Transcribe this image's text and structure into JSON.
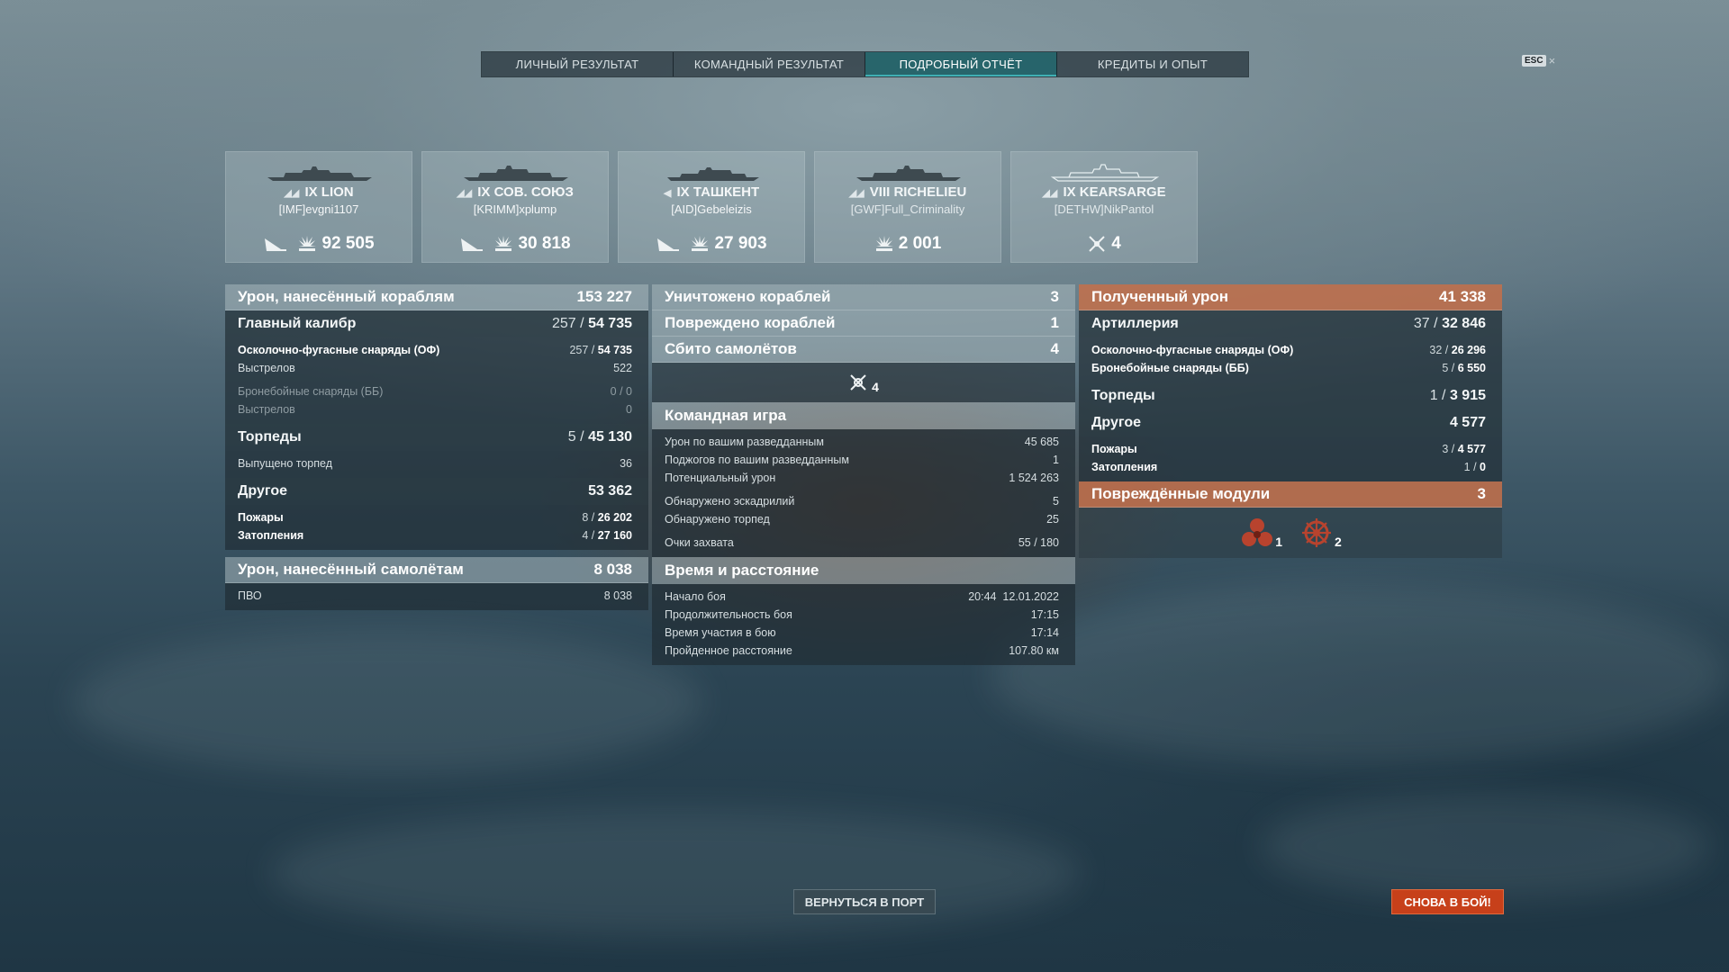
{
  "tabs": [
    {
      "label": "ЛИЧНЫЙ РЕЗУЛЬТАТ",
      "active": false
    },
    {
      "label": "КОМАНДНЫЙ РЕЗУЛЬТАТ",
      "active": false
    },
    {
      "label": "ПОДРОБНЫЙ ОТЧЁТ",
      "active": true
    },
    {
      "label": "КРЕДИТЫ И ОПЫТ",
      "active": false
    }
  ],
  "esc": {
    "key": "ESC",
    "close": "×"
  },
  "ships": [
    {
      "tier": "IX",
      "name": "LION",
      "player": "[IMF]evgni1107",
      "damage": "92 505"
    },
    {
      "tier": "IX",
      "name": "СОВ. СОЮЗ",
      "player": "[KRIMM]xplump",
      "damage": "30 818"
    },
    {
      "tier": "IX",
      "name": "ТАШКЕНТ",
      "player": "[AID]Gebeleizis",
      "damage": "27 903"
    },
    {
      "tier": "VIII",
      "name": "RICHELIEU",
      "player": "[GWF]Full_Criminality",
      "damage": "2 001"
    },
    {
      "tier": "IX",
      "name": "KEARSARGE",
      "player": "[DETHW]NikPantol",
      "planes": "4"
    }
  ],
  "left": {
    "ship_damage": {
      "label": "Урон, нанесённый кораблям",
      "value": "153 227"
    },
    "main_battery": {
      "label": "Главный калибр",
      "hits": "257",
      "sep": "/",
      "damage": "54 735"
    },
    "he": {
      "label": "Осколочно-фугасные снаряды (ОФ)",
      "hits": "257",
      "sep": "/",
      "damage": "54 735"
    },
    "he_shots": {
      "label": "Выстрелов",
      "value": "522"
    },
    "ap": {
      "label": "Бронебойные снаряды (ББ)",
      "value": "0 / 0"
    },
    "ap_shots": {
      "label": "Выстрелов",
      "value": "0"
    },
    "torpedoes": {
      "label": "Торпеды",
      "hits": "5",
      "sep": "/",
      "damage": "45 130"
    },
    "torp_launched": {
      "label": "Выпущено торпед",
      "value": "36"
    },
    "other": {
      "label": "Другое",
      "value": "53 362"
    },
    "fires": {
      "label": "Пожары",
      "count": "8",
      "sep": "/",
      "damage": "26 202"
    },
    "floods": {
      "label": "Затопления",
      "count": "4",
      "sep": "/",
      "damage": "27 160"
    },
    "plane_damage": {
      "label": "Урон, нанесённый самолётам",
      "value": "8 038"
    },
    "aa": {
      "label": "ПВО",
      "value": "8 038"
    }
  },
  "middle": {
    "destroyed": {
      "label": "Уничтожено кораблей",
      "value": "3"
    },
    "damaged": {
      "label": "Повреждено кораблей",
      "value": "1"
    },
    "planes": {
      "label": "Сбито самолётов",
      "value": "4"
    },
    "planes_icon_value": "4",
    "teamplay": {
      "title": "Командная игра",
      "rows": [
        {
          "label": "Урон по вашим разведданным",
          "value": "45 685"
        },
        {
          "label": "Поджогов по вашим разведданным",
          "value": "1"
        },
        {
          "label": "Потенциальный урон",
          "value": "1 524 263"
        },
        {
          "label": "Обнаружено эскадрилий",
          "value": "5"
        },
        {
          "label": "Обнаружено торпед",
          "value": "25"
        },
        {
          "label": "Очки захвата",
          "value": "55 / 180"
        }
      ]
    },
    "time": {
      "title": "Время и расстояние",
      "rows": [
        {
          "label": "Начало боя",
          "value": "20:44  12.01.2022"
        },
        {
          "label": "Продолжительность боя",
          "value": "17:15"
        },
        {
          "label": "Время участия в бою",
          "value": "17:14"
        },
        {
          "label": "Пройденное расстояние",
          "value": "107.80 км"
        }
      ]
    }
  },
  "right": {
    "received": {
      "label": "Полученный урон",
      "value": "41 338"
    },
    "artillery": {
      "label": "Артиллерия",
      "hits": "37",
      "sep": "/",
      "damage": "32 846"
    },
    "he": {
      "label": "Осколочно-фугасные снаряды (ОФ)",
      "hits": "32",
      "sep": "/",
      "damage": "26 296"
    },
    "ap": {
      "label": "Бронебойные снаряды (ББ)",
      "hits": "5",
      "sep": "/",
      "damage": "6 550"
    },
    "torpedoes": {
      "label": "Торпеды",
      "hits": "1",
      "sep": "/",
      "damage": "3 915"
    },
    "other": {
      "label": "Другое",
      "value": "4 577"
    },
    "fires": {
      "label": "Пожары",
      "count": "3",
      "sep": "/",
      "damage": "4 577"
    },
    "floods": {
      "label": "Затопления",
      "count": "1",
      "sep": "/",
      "damage": "0"
    },
    "modules": {
      "label": "Повреждённые модули",
      "value": "3"
    },
    "module_items": [
      {
        "icon": "propeller-icon",
        "count": "1"
      },
      {
        "icon": "steering-wheel-icon",
        "count": "2"
      }
    ]
  },
  "buttons": {
    "port": "ВЕРНУТЬСЯ В ПОРТ",
    "battle": "СНОВА В БОЙ!"
  },
  "colors": {
    "accent_orange": "#c7401a",
    "tab_active": "#185c62",
    "received_header": "#c4704a"
  }
}
